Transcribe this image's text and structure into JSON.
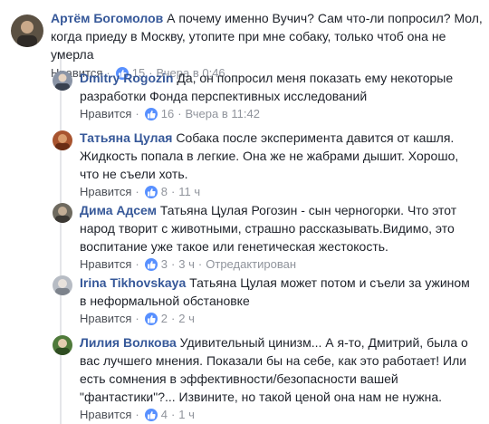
{
  "comments": [
    {
      "author": "Артём Богомолов",
      "text": "А почему именно Вучич? Сам что-ли попросил? Мол, когда приеду в Москву, утопите при мне собаку, только чтоб она не умерла",
      "like_label": "Нравится",
      "likes": "15",
      "time": "Вчера в 0:46",
      "edited": ""
    },
    {
      "author": "Dmitry Rogozin",
      "text": "Да, он попросил меня показать ему некоторые разработки Фонда перспективных исследований",
      "like_label": "Нравится",
      "likes": "16",
      "time": "Вчера в 11:42",
      "edited": ""
    },
    {
      "author": "Татьяна Цулая",
      "text": "Собака после эксперимента давится от кашля. Жидкость попала в легкие. Она же не жабрами дышит. Хорошо, что не съели хоть.",
      "like_label": "Нравится",
      "likes": "8",
      "time": "11 ч",
      "edited": ""
    },
    {
      "author": "Дима Адсем",
      "text": "Татьяна Цулая Рогозин - сын черногорки. Что этот народ творит с животными, страшно рассказывать.Видимо, это воспитание уже такое или генетическая жестокость.",
      "like_label": "Нравится",
      "likes": "3",
      "time": "3 ч",
      "edited": "Отредактирован"
    },
    {
      "author": "Irina Tikhovskaya",
      "text": "Татьяна Цулая может потом и съели за ужином в неформальной обстановке",
      "like_label": "Нравится",
      "likes": "2",
      "time": "2 ч",
      "edited": ""
    },
    {
      "author": "Лилия Волкова",
      "text": "Удивительный цинизм... А я-то, Дмитрий, была о вас лучшего мнения. Показали бы на себе, как это работает! Или есть сомнения в эффективности/безопасности вашей \"фантастики\"?... Извините, но такой ценой она нам не нужна.",
      "like_label": "Нравится",
      "likes": "4",
      "time": "1 ч",
      "edited": ""
    }
  ],
  "colors": {
    "author": "#365899",
    "meta": "#90949c",
    "like_badge": "#5890ff",
    "thread_line": "#e5e6e9"
  },
  "icons": {
    "like": "thumbs-up-icon",
    "avatar": "user-avatar"
  }
}
